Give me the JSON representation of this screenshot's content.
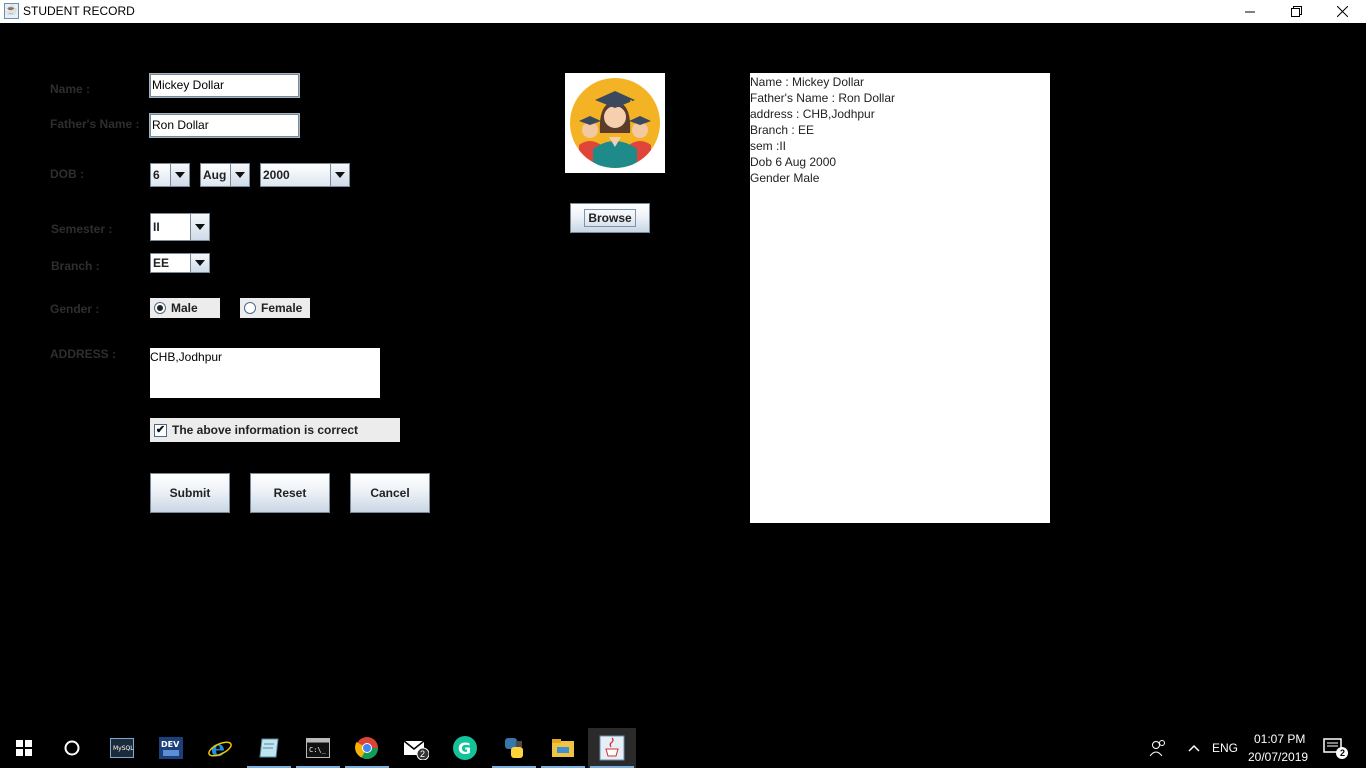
{
  "window": {
    "title": "STUDENT RECORD",
    "icon": "java-cup-icon"
  },
  "form": {
    "name_label": "Name :",
    "name_value": "Mickey Dollar",
    "father_label": "Father's Name :",
    "father_value": "Ron Dollar",
    "dob_label": "DOB :",
    "dob_day": "6",
    "dob_month": "Aug",
    "dob_year": "2000",
    "semester_label": "Semester :",
    "semester_value": "II",
    "branch_label": "Branch :",
    "branch_value": "EE",
    "gender_label": "Gender :",
    "gender_male": "Male",
    "gender_female": "Female",
    "gender_selected": "Male",
    "address_label": "ADDRESS :",
    "address_value": "CHB,Jodhpur",
    "confirm_label": "The above information is correct",
    "confirm_checked": true,
    "submit_label": "Submit",
    "reset_label": "Reset",
    "cancel_label": "Cancel",
    "browse_label": "Browse"
  },
  "output": {
    "lines": [
      "Name : Mickey Dollar",
      "Father's Name : Ron Dollar",
      "address : CHB,Jodhpur",
      "Branch : EE",
      "sem :II",
      "Dob 6 Aug 2000",
      "Gender Male"
    ]
  },
  "taskbar": {
    "items": [
      "windows-start-icon",
      "cortana-icon",
      "mysql-icon",
      "dev-cpp-icon",
      "internet-explorer-icon",
      "notepad-icon",
      "cmd-icon",
      "chrome-icon",
      "mail-icon",
      "grammarly-icon",
      "python-icon",
      "file-explorer-icon",
      "java-icon"
    ],
    "mail_badge": "2",
    "language": "ENG",
    "time": "01:07 PM",
    "date": "20/07/2019",
    "notification_badge": "2"
  },
  "colors": {
    "background": "#000000",
    "label": "#2e2e2e",
    "panel": "#ffffff",
    "avatar_circle": "#f4b324",
    "avatar_gown": "#1f8a8a",
    "avatar_cap": "#3a4a5c"
  }
}
